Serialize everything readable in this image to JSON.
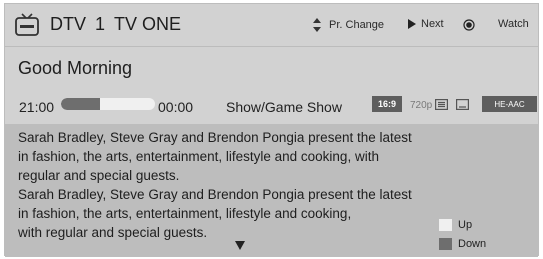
{
  "header": {
    "channel_type": "DTV",
    "channel_number": "1",
    "channel_name": "TV ONE",
    "pr_change_label": "Pr. Change",
    "next_label": "Next",
    "watch_label": "Watch"
  },
  "program": {
    "title": "Good Morning",
    "start_time": "21:00",
    "end_time": "00:00",
    "progress_fraction": 0.42,
    "genre": "Show/Game Show",
    "aspect_ratio": "16:9",
    "resolution": "720p",
    "audio": "HE-AAC",
    "description_lines": [
      "Sarah Bradley, Steve Gray and Brendon Pongia present the latest",
      "in fashion, the arts, entertainment, lifestyle and cooking, with",
      "regular and special guests.",
      "Sarah Bradley, Steve Gray and Brendon Pongia present the latest",
      "in fashion, the arts, entertainment, lifestyle and cooking,",
      "with regular and special guests."
    ]
  },
  "scroll_keys": {
    "up_label": "Up",
    "down_label": "Down"
  },
  "colors": {
    "panel": "#d2d2d2",
    "description_box": "#bdbdbd",
    "badge": "#5e5e5e",
    "progress_track": "#f0f0f0",
    "progress_fill": "#6e6e6e"
  },
  "icons": [
    "tv-icon",
    "updown-icon",
    "play-icon",
    "record-icon",
    "teletext-icon",
    "subtitle-icon",
    "scroll-down-icon"
  ]
}
